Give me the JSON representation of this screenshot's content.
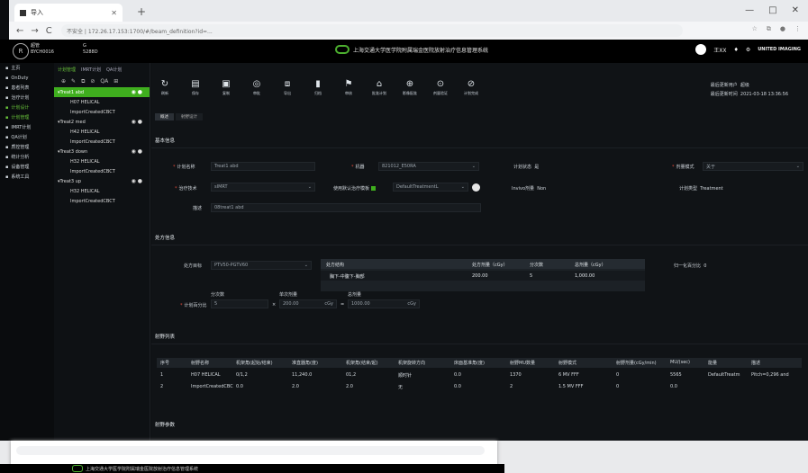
{
  "browser": {
    "tab_title": "导入",
    "url": "不安全 | 172.26.17.153:1700/#/beam_definition?id=...",
    "win_controls": [
      "—",
      "□",
      "✕"
    ]
  },
  "header": {
    "user_name": "超管",
    "user_id": "BYCH0016",
    "project_name": "G",
    "project_id": "5288D",
    "system_title": "上海交通大学医学院附属瑞金医院放射治疗信息管理系统",
    "right_user": "王XX",
    "brand_text": "UNITED IMAGING"
  },
  "sidebar": {
    "items": [
      {
        "label": "主页"
      },
      {
        "label": "OnDuty"
      },
      {
        "label": "患者列表"
      },
      {
        "label": "治疗计划"
      },
      {
        "label": "计划设计",
        "active": true
      },
      {
        "label": "计划管理",
        "active": true
      },
      {
        "label": "IMRT计划"
      },
      {
        "label": "QA计划"
      },
      {
        "label": "质控管理"
      },
      {
        "label": "统计分析"
      },
      {
        "label": "设备管理"
      },
      {
        "label": "系统工具"
      }
    ]
  },
  "tree": {
    "tabs": [
      "计划管理",
      "IMRT计划",
      "QA计划"
    ],
    "nodes": [
      {
        "label": "Treat1 abd",
        "selected": true,
        "children": [
          "H07 HELICAL",
          "ImportCreatedCBCT"
        ]
      },
      {
        "label": "Treat2 med",
        "selected": false,
        "children": [
          "H42 HELICAL",
          "ImportCreatedCBCT"
        ]
      },
      {
        "label": "Treat3 down",
        "selected": false,
        "children": [
          "H32 HELICAL",
          "ImportCreatedCBCT"
        ]
      },
      {
        "label": "Treat3 up",
        "selected": false,
        "children": [
          "H32 HELICAL",
          "ImportCreatedCBCT"
        ]
      }
    ]
  },
  "toolbar": {
    "items": [
      {
        "icon": "↻",
        "label": "刷新"
      },
      {
        "icon": "▤",
        "label": "保存"
      },
      {
        "icon": "▣",
        "label": "复制"
      },
      {
        "icon": "◎",
        "label": "审批"
      },
      {
        "icon": "⧈",
        "label": "导出"
      },
      {
        "icon": "▮",
        "label": "归档"
      },
      {
        "icon": "⚑",
        "label": "审核"
      },
      {
        "icon": "⌂",
        "label": "批准计划"
      },
      {
        "icon": "⊕",
        "label": "影像配准"
      },
      {
        "icon": "⊙",
        "label": "剂量验证"
      },
      {
        "icon": "⊘",
        "label": "计划完成"
      }
    ]
  },
  "info": {
    "label_1": "最后更新用户",
    "value_1": "超级",
    "label_2": "最后更新时间",
    "value_2": "2021-03-18 13:36:56"
  },
  "subtabs": [
    "概述",
    "射野设计"
  ],
  "basic": {
    "title": "基本信息",
    "plan_name_label": "计划名称",
    "plan_name_value": "Treat1 abd",
    "machine_label": "机器",
    "machine_value": "821012_E50RA",
    "status_label": "计划状态",
    "status_value": "是",
    "dose_label": "剂量模式",
    "dose_value": "关于",
    "technique_label": "治疗技术",
    "technique_value": "sIMRT",
    "template_label": "使用默认治疗模板",
    "template_value": "DefaultTreatmentL",
    "invivo_label": "Invivo剂量",
    "invivo_value": "Non",
    "plan_type_label": "计划类型",
    "plan_type_value": "Treatment",
    "desc_label": "描述",
    "desc_value": "08treat1 abd"
  },
  "rx": {
    "title": "处方信息",
    "target_label": "处方目标",
    "target_value": "PTV50-PGTV60",
    "structure_head": "处方结构",
    "dose_head": "处方剂量（cGy）",
    "fraction_head": "分次数",
    "total_head": "总剂量（cGy）",
    "structure_value": "胸下-中腹下-胸部",
    "dose_value": "200.00",
    "fraction_value": "5",
    "total_value": "1,000.00",
    "normalize_label": "归一化百分比",
    "normalize_value": "0",
    "frac_label": "分次数",
    "frac_value": "5",
    "single_label": "单次剂量",
    "single_value": "200.00",
    "single_unit": "cGy",
    "total_label": "总剂量",
    "total_value2": "1000.00",
    "total_unit": "cGy",
    "pct_label": "计划百分比"
  },
  "beams": {
    "title": "射野列表",
    "headers": [
      "序号",
      "射野名称",
      "机架角(起始/结束)",
      "准直器角(度)",
      "机架角(结束/起)",
      "机架旋转方向",
      "床面基准角(度)",
      "射野MU数量",
      "射野模式",
      "射野剂量(cGy/min)",
      "MU/(sec)",
      "能量",
      "描述"
    ],
    "rows": [
      [
        "1",
        "H07 HELICAL",
        "0/1,2",
        "11,240.0",
        "01,2",
        "顺时针",
        "0.0",
        "1370",
        "6 MV FFF",
        "0",
        "5565",
        "DefaultTreatm",
        "Pitch=0,296 and"
      ],
      [
        "2",
        "ImportCreatedCBC",
        "0.0",
        "2.0",
        "2.0",
        "无",
        "0.0",
        "2",
        "1.5 MV FFF",
        "0",
        "0.0",
        "",
        ""
      ]
    ]
  },
  "after_table_title": "射野参数",
  "popup": {
    "taskbar_title": "上海交通大学医学院附属瑞金医院放射治疗信息管理系统"
  }
}
